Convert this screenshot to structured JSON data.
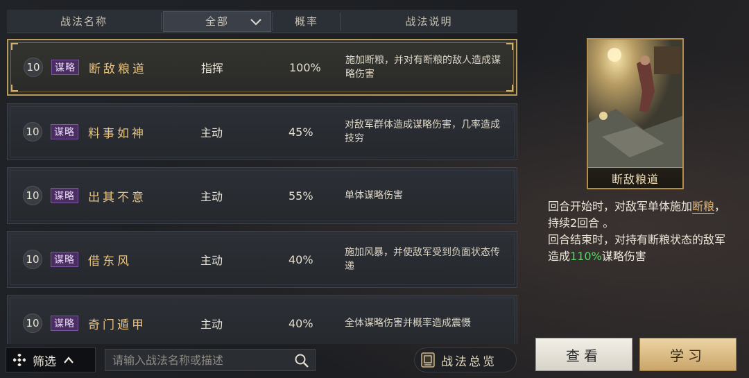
{
  "header": {
    "col_name": "战法名称",
    "col_filter": "全部",
    "col_rate": "概率",
    "col_desc": "战法说明"
  },
  "skills": [
    {
      "level": "10",
      "type": "谋略",
      "name": "断敌粮道",
      "kind": "指挥",
      "rate": "100%",
      "desc": "施加断粮，并对有断粮的敌人造成谋略伤害"
    },
    {
      "level": "10",
      "type": "谋略",
      "name": "料事如神",
      "kind": "主动",
      "rate": "45%",
      "desc": "对敌军群体造成谋略伤害，几率造成技穷"
    },
    {
      "level": "10",
      "type": "谋略",
      "name": "出其不意",
      "kind": "主动",
      "rate": "55%",
      "desc": "单体谋略伤害"
    },
    {
      "level": "10",
      "type": "谋略",
      "name": "借东风",
      "kind": "主动",
      "rate": "40%",
      "desc": "施加风暴，并使敌军受到负面状态传递"
    },
    {
      "level": "10",
      "type": "谋略",
      "name": "奇门遁甲",
      "kind": "主动",
      "rate": "40%",
      "desc": "全体谋略伤害并概率造成震慑"
    }
  ],
  "detail": {
    "card_name": "断敌粮道",
    "line1_a": "回合开始时，对敌军单体施加",
    "line1_hl": "断粮",
    "line1_b": "，持续2回合 。",
    "line2_a": "回合结束时，对持有断粮状态的敌军造成",
    "line2_hl": "110%",
    "line2_b": "谋略伤害"
  },
  "buttons": {
    "view": "查看",
    "learn": "学习"
  },
  "bottom": {
    "filter_label": "筛选",
    "search_placeholder": "请输入战法名称或描述",
    "overview_label": "战法总览"
  },
  "colors": {
    "accent_gold": "#e2b46a",
    "highlight_green": "#5cd66a",
    "badge_purple": "#4a2e62"
  }
}
